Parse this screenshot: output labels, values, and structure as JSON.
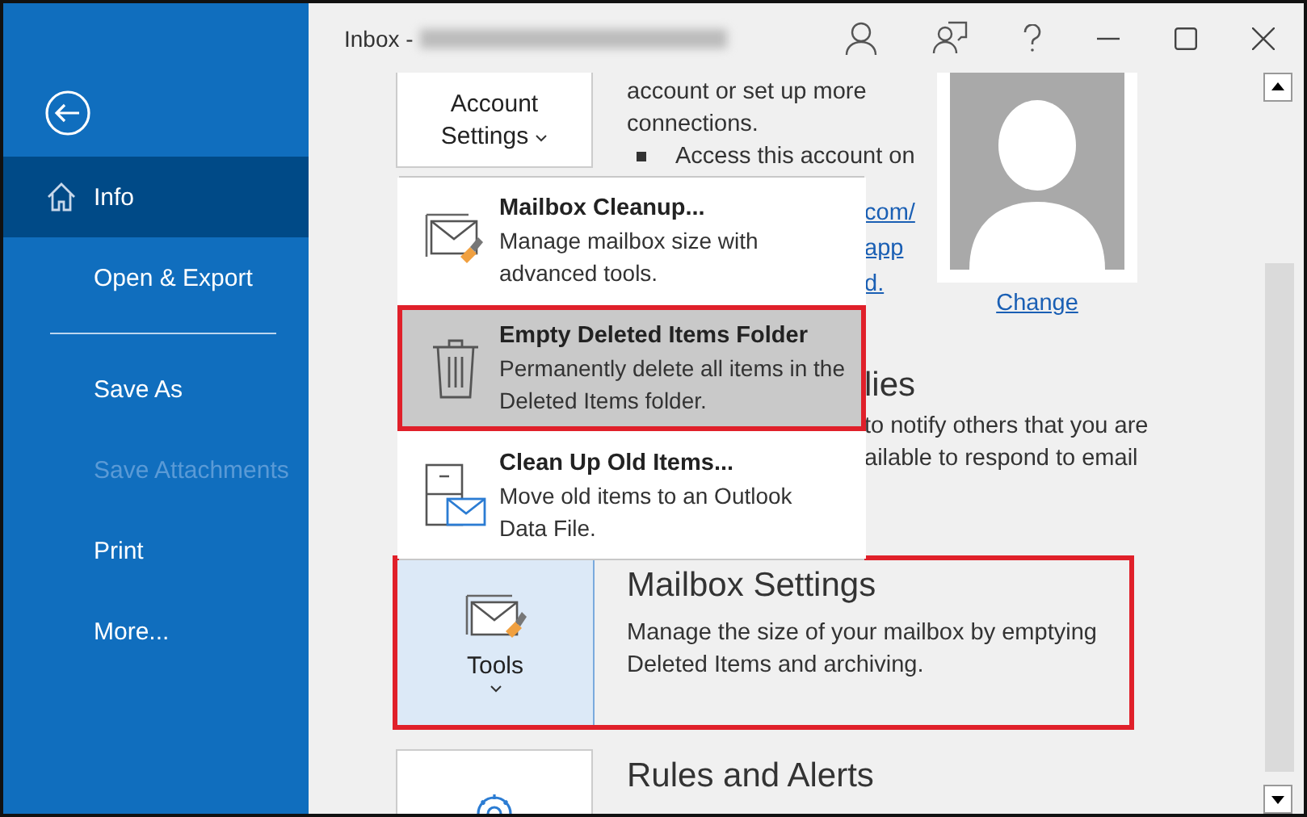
{
  "window": {
    "title": "Inbox -"
  },
  "sidebar": {
    "items": [
      {
        "kind": "home",
        "label": "Info",
        "selected": true,
        "disabled": false
      },
      {
        "kind": "item",
        "label": "Open & Export",
        "selected": false,
        "disabled": false
      },
      {
        "kind": "separator"
      },
      {
        "kind": "item",
        "label": "Save As",
        "selected": false,
        "disabled": false
      },
      {
        "kind": "item",
        "label": "Save Attachments",
        "selected": false,
        "disabled": true
      },
      {
        "kind": "item",
        "label": "Print",
        "selected": false,
        "disabled": false
      },
      {
        "kind": "item",
        "label": "More...",
        "selected": false,
        "disabled": false
      }
    ]
  },
  "account_section": {
    "button": "Account Settings",
    "text": "account or set up more connections.",
    "bullet": "Access this account on",
    "link_fragments": [
      "com/",
      "app",
      "d."
    ],
    "change_link": "Change"
  },
  "auto_replies_section": {
    "heading_fragment": "lies",
    "text_fragments": [
      "to notify others that you are",
      "ailable to respond to email"
    ]
  },
  "tools_menu": {
    "items": [
      {
        "kind": "cleanup",
        "title": "Mailbox Cleanup...",
        "description": "Manage mailbox size with advanced tools.",
        "selected": false,
        "annotated": false
      },
      {
        "kind": "trash",
        "title": "Empty Deleted Items Folder",
        "description": "Permanently delete all items in the Deleted Items folder.",
        "selected": true,
        "annotated": true
      },
      {
        "kind": "archive",
        "title": "Clean Up Old Items...",
        "description": "Move old items to an Outlook Data File.",
        "selected": false,
        "annotated": false
      }
    ]
  },
  "mailbox_section": {
    "button": "Tools",
    "heading": "Mailbox Settings",
    "description": "Manage the size of your mailbox by emptying Deleted Items and archiving.",
    "annotated": true
  },
  "rules_section": {
    "heading": "Rules and Alerts"
  }
}
